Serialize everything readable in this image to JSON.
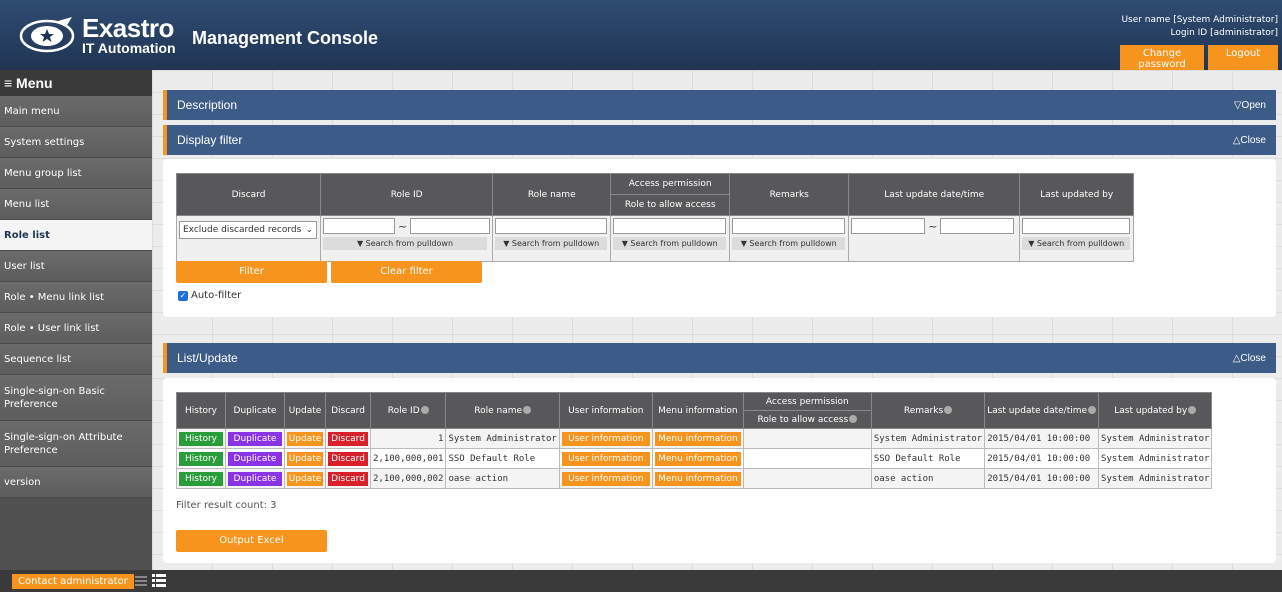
{
  "header": {
    "logo_name": "Exastro",
    "logo_sub": "IT Automation",
    "title": "Management Console",
    "user_name_line": "User name [System Administrator]",
    "login_id_line": "Login ID [administrator]",
    "change_password": "Change password",
    "logout": "Logout",
    "brand_color": "#1f3553",
    "accent_color": "#f7941d"
  },
  "sidebar": {
    "menu_icon": "hamburger-icon",
    "menu_title": "≡ Menu",
    "items": [
      {
        "label": "Main menu"
      },
      {
        "label": "System settings"
      },
      {
        "label": "Menu group list"
      },
      {
        "label": "Menu list"
      },
      {
        "label": "Role list",
        "active": true
      },
      {
        "label": "User list"
      },
      {
        "label": "Role • Menu link list"
      },
      {
        "label": "Role • User link list"
      },
      {
        "label": "Sequence list"
      },
      {
        "label": "Single-sign-on Basic Preference"
      },
      {
        "label": "Single-sign-on Attribute Preference"
      },
      {
        "label": "version"
      }
    ]
  },
  "sections": {
    "description": {
      "title": "Description",
      "toggle": "▽Open"
    },
    "display_filter": {
      "title": "Display filter",
      "toggle": "△Close"
    },
    "list_update": {
      "title": "List/Update",
      "toggle": "△Close"
    }
  },
  "filter": {
    "headers": {
      "discard": "Discard",
      "role_id": "Role ID",
      "role_name": "Role name",
      "access_permission": "Access permission",
      "role_to_allow": "Role to allow access",
      "remarks": "Remarks",
      "last_update": "Last update date/time",
      "last_updated_by": "Last updated by"
    },
    "discard_select": "Exclude discarded records",
    "range_sep": "~",
    "pulldown": "▼ Search from pulldown",
    "filter_btn": "Filter",
    "clear_btn": "Clear filter",
    "auto_filter": "Auto-filter"
  },
  "list": {
    "headers": {
      "history": "History",
      "duplicate": "Duplicate",
      "update": "Update",
      "discard": "Discard",
      "role_id": "Role ID",
      "role_name": "Role name",
      "user_info": "User information",
      "menu_info": "Menu information",
      "access_permission": "Access permission",
      "role_to_allow": "Role to allow access",
      "remarks": "Remarks",
      "last_update": "Last update date/time",
      "last_updated_by": "Last updated by"
    },
    "buttons": {
      "history": "History",
      "duplicate": "Duplicate",
      "update": "Update",
      "discard": "Discard",
      "user_info": "User information",
      "menu_info": "Menu information"
    },
    "rows": [
      {
        "role_id": "1",
        "role_name": "System Administrator",
        "access": "",
        "remarks": "System Administrator",
        "last_update": "2015/04/01 10:00:00",
        "updated_by": "System Administrator"
      },
      {
        "role_id": "2,100,000,001",
        "role_name": "SSO Default Role",
        "access": "",
        "remarks": "SSO Default Role",
        "last_update": "2015/04/01 10:00:00",
        "updated_by": "System Administrator"
      },
      {
        "role_id": "2,100,000,002",
        "role_name": "oase action",
        "access": "",
        "remarks": "oase action",
        "last_update": "2015/04/01 10:00:00",
        "updated_by": "System Administrator"
      }
    ],
    "result_count": "Filter result count: 3",
    "output_excel": "Output Excel"
  },
  "footer": {
    "contact": "Contact administrator",
    "icons": [
      "list-collapse-icon",
      "list-expand-icon"
    ]
  }
}
